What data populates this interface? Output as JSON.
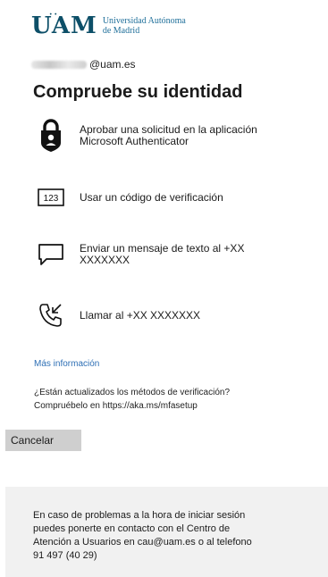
{
  "header": {
    "logo_mark": "UAM",
    "logo_line1": "Universidad Autónoma",
    "logo_line2": "de Madrid"
  },
  "account": {
    "email_suffix": "@uam.es"
  },
  "title": "Compruebe su identidad",
  "options": [
    {
      "icon": "authenticator-lock-icon",
      "line1": "Aprobar una solicitud en la aplicación",
      "line2": "Microsoft Authenticator"
    },
    {
      "icon": "code-123-icon",
      "code_text": "123",
      "line1": "Usar un código de verificación"
    },
    {
      "icon": "message-icon",
      "line1": "Enviar un mensaje de texto al +XX",
      "line2": "XXXXXXX"
    },
    {
      "icon": "phone-icon",
      "line1": "Llamar al +XX XXXXXXX"
    }
  ],
  "more_info": "Más información",
  "note": {
    "line1": "¿Están actualizados los métodos de verificación?",
    "line2": "Compruébelo en https://aka.ms/mfasetup"
  },
  "cancel_label": "Cancelar",
  "footer": {
    "line1": "En caso de problemas a la hora de iniciar sesión",
    "line2": "puedes ponerte en contacto con el Centro de",
    "line3": "Atención a Usuarios en cau@uam.es o al telefono",
    "line4": "91 497 (40 29)"
  },
  "colors": {
    "brand": "#0d4f68",
    "link": "#2d6fb5",
    "button": "#cfcfcf",
    "footer_bg": "#f1f1f1"
  }
}
